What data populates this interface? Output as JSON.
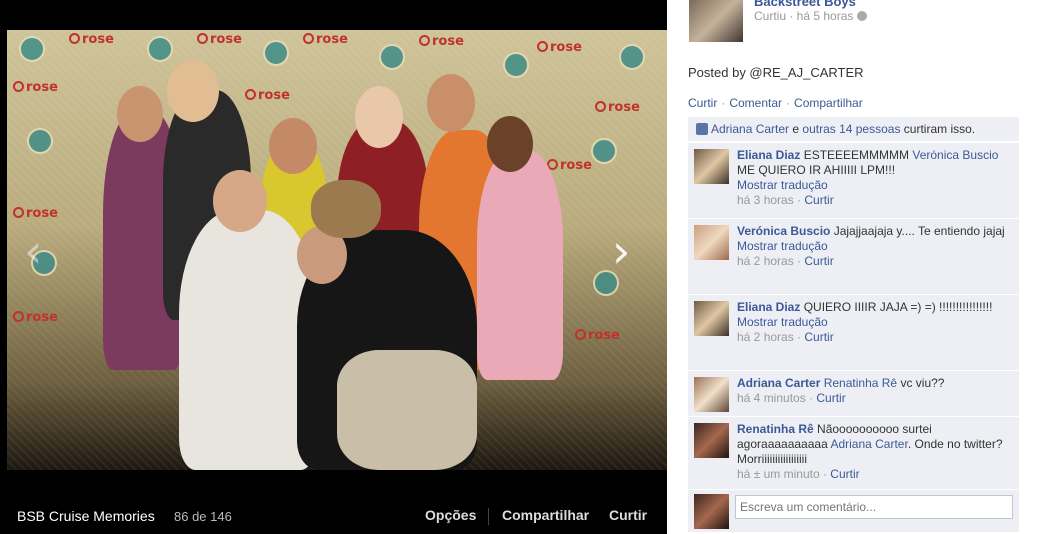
{
  "viewer": {
    "album_title": "BSB Cruise Memories",
    "position": "86 de 146",
    "options_label": "Opções",
    "share_label": "Compartilhar",
    "like_label": "Curtir",
    "prev_arrow": "‹",
    "next_arrow": "›",
    "backdrop_logo": "rose"
  },
  "sidebar": {
    "owner_name": "Backstreet Boys",
    "owner_meta": "Curtiu · há 5 horas",
    "posted_by": "Posted by @RE_AJ_CARTER",
    "actions": [
      "Curtir",
      "Comentar",
      "Compartilhar"
    ],
    "likes": {
      "name": "Adriana Carter",
      "joiner": " e ",
      "others": "outras 14 pessoas",
      "suffix": " curtiram isso."
    },
    "comments": [
      {
        "author": "Eliana Diaz",
        "text": " ESTEEEEMMMMM ",
        "mention": "Verónica Buscio",
        "text2": " ME QUIERO IR AHIIIII LPM!!!",
        "translate": "Mostrar tradução",
        "time": "há 3 horas",
        "like": "Curtir"
      },
      {
        "author": "Verónica Buscio",
        "text": " Jajajjaajaja y.... Te entiendo jajaj",
        "translate": "Mostrar tradução",
        "time": "há 2 horas",
        "like": "Curtir"
      },
      {
        "author": "Eliana Diaz",
        "text": " QUIERO IIIIR JAJA =) =) !!!!!!!!!!!!!!!!",
        "translate": "Mostrar tradução",
        "time": "há 2 horas",
        "like": "Curtir"
      },
      {
        "author": "Adriana Carter",
        "mention": "Renatinha Rê",
        "text": " vc viu??",
        "time": "há 4 minutos",
        "like": "Curtir"
      },
      {
        "author": "Renatinha Rê",
        "text": " Nãoooooooooo surtei agoraaaaaaaaaa ",
        "mention": "Adriana Carter",
        "text2": ". Onde no twitter? Morriiiiiiiiiiiiiiiii",
        "time": "há ± um minuto",
        "like": "Curtir"
      }
    ],
    "compose_placeholder": "Escreva um comentário..."
  },
  "colors": {
    "link": "#3b5998",
    "panel": "#edeff4",
    "viewer_bg": "#000000"
  }
}
